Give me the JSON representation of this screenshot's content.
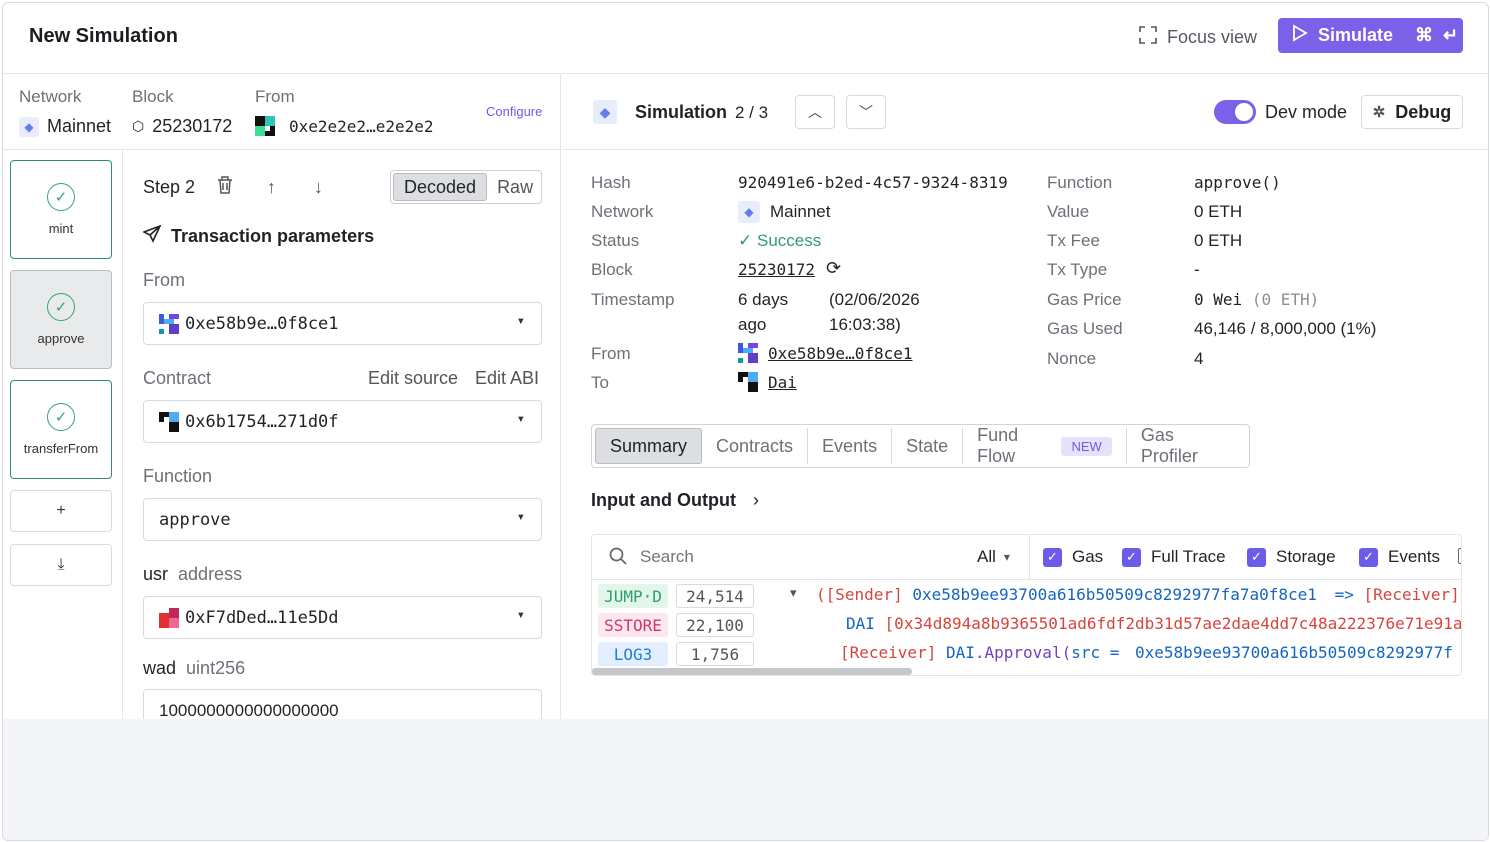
{
  "header": {
    "title": "New Simulation",
    "focus_view": "Focus view",
    "simulate": "Simulate"
  },
  "meta": {
    "network_label": "Network",
    "network_value": "Mainnet",
    "block_label": "Block",
    "block_value": "25230172",
    "from_label": "From",
    "from_value": "0xe2e2e2…e2e2e2",
    "configure": "Configure"
  },
  "steps": [
    {
      "name": "mint"
    },
    {
      "name": "approve"
    },
    {
      "name": "transferFrom"
    }
  ],
  "step_buttons": {
    "add": "+",
    "download": "⤓"
  },
  "form": {
    "step_label": "Step 2",
    "decoded": "Decoded",
    "raw": "Raw",
    "section_title": "Transaction parameters",
    "from_label": "From",
    "from_value": "0xe58b9e…0f8ce1",
    "contract_label": "Contract",
    "edit_source": "Edit source",
    "edit_abi": "Edit ABI",
    "contract_value": "0x6b1754…271d0f",
    "function_label": "Function",
    "function_value": "approve",
    "usr_name": "usr",
    "usr_type": "address",
    "usr_value": "0xF7dDed…11e5Dd",
    "wad_name": "wad",
    "wad_type": "uint256",
    "wad_value": "1000000000000000000"
  },
  "sim": {
    "title": "Simulation",
    "counter": "2 / 3",
    "dev_mode": "Dev mode",
    "debug": "Debug",
    "hash_label": "Hash",
    "hash_value": "920491e6-b2ed-4c57-9324-8319",
    "network_label": "Network",
    "network_value": "Mainnet",
    "status_label": "Status",
    "status_value": "Success",
    "block_label": "Block",
    "block_value": "25230172",
    "timestamp_label": "Timestamp",
    "ts_rel_1": "6 days",
    "ts_rel_2": "ago",
    "ts_abs_1": "(02/06/2026",
    "ts_abs_2": "16:03:38)",
    "from_label": "From",
    "from_value": "0xe58b9e…0f8ce1",
    "to_label": "To",
    "to_value": "Dai",
    "function_label": "Function",
    "function_value": "approve()",
    "value_label": "Value",
    "value_value": "0 ETH",
    "txfee_label": "Tx Fee",
    "txfee_value": "0 ETH",
    "txtype_label": "Tx Type",
    "txtype_value": "-",
    "gasprice_label": "Gas Price",
    "gasprice_wei": "0 Wei",
    "gasprice_eth": "(0 ETH)",
    "gasused_label": "Gas Used",
    "gasused_value": "46,146 / 8,000,000 (1%)",
    "nonce_label": "Nonce",
    "nonce_value": "4"
  },
  "tabs": [
    {
      "label": "Summary"
    },
    {
      "label": "Contracts"
    },
    {
      "label": "Events"
    },
    {
      "label": "State"
    },
    {
      "label": "Fund Flow"
    },
    {
      "label": "Gas Profiler"
    }
  ],
  "new_badge": "NEW",
  "io_title": "Input and Output",
  "trace": {
    "search_placeholder": "Search",
    "filter": "All",
    "checks": [
      "Gas",
      "Full Trace",
      "Storage",
      "Events"
    ],
    "rows": [
      {
        "op": "JUMP·D",
        "gas": "24,514",
        "a": "([Sender]",
        "b": "0xe58b9ee93700a616b50509c8292977fa7a0f8ce1",
        "c": "=>",
        "d": "[Receiver]"
      },
      {
        "op": "SSTORE",
        "gas": "22,100",
        "a": "DAI",
        "b": "[0x34d894a8b9365501ad6fdf2db31d57ae2dae4dd7c48a222376e71e91a"
      },
      {
        "op": "LOG3",
        "gas": "1,756",
        "a": "[Receiver]",
        "b": "DAI",
        "c": ".Approval(",
        "d": "src =",
        "e": "0xe58b9ee93700a616b50509c8292977f"
      }
    ]
  },
  "colors": {
    "accent": "#7b61e8",
    "success": "#35a37a"
  }
}
